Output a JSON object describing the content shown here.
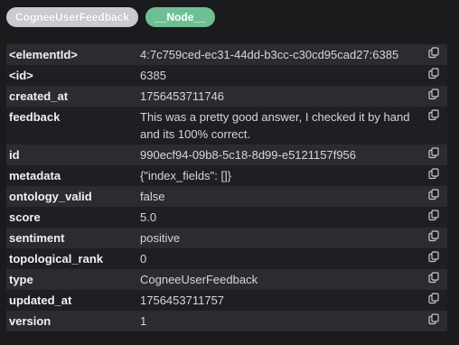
{
  "badges": {
    "relationship": "CogneeUserFeedback",
    "node": "__Node__"
  },
  "properties": [
    {
      "key": "<elementId>",
      "value": "4:7c759ced-ec31-44dd-b3cc-c30cd95cad27:6385"
    },
    {
      "key": "<id>",
      "value": "6385"
    },
    {
      "key": "created_at",
      "value": "1756453711746"
    },
    {
      "key": "feedback",
      "value": "This was a pretty good answer, I checked it by hand and its 100% correct."
    },
    {
      "key": "id",
      "value": "990ecf94-09b8-5c18-8d99-e5121157f956"
    },
    {
      "key": "metadata",
      "value": "{\"index_fields\": []}"
    },
    {
      "key": "ontology_valid",
      "value": "false"
    },
    {
      "key": "score",
      "value": "5.0"
    },
    {
      "key": "sentiment",
      "value": "positive"
    },
    {
      "key": "topological_rank",
      "value": "0"
    },
    {
      "key": "type",
      "value": "CogneeUserFeedback"
    },
    {
      "key": "updated_at",
      "value": "1756453711757"
    },
    {
      "key": "version",
      "value": "1"
    }
  ],
  "icons": {
    "copy": "copy-icon"
  }
}
